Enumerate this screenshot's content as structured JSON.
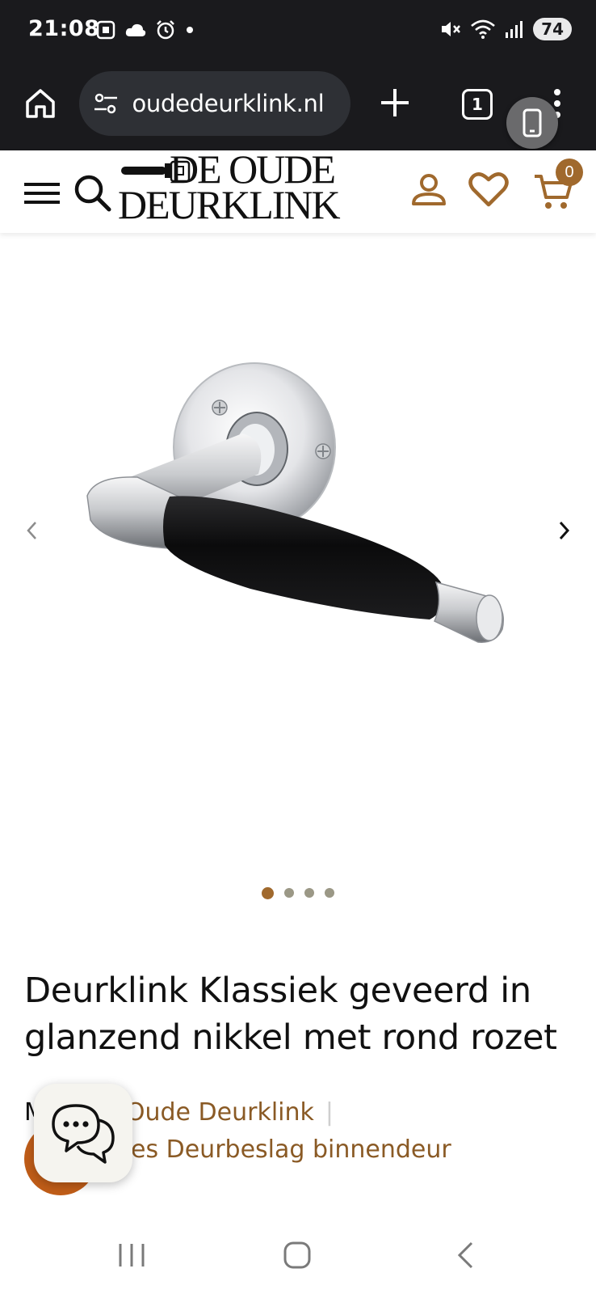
{
  "status_bar": {
    "time": "21:08",
    "left_icons": [
      "screenshot-icon",
      "cloud-icon",
      "alarm-icon",
      "dot-icon"
    ],
    "right_icons": [
      "mute-icon",
      "wifi-icon",
      "signal-icon"
    ],
    "battery": "74"
  },
  "browser": {
    "url": "deoudedeurklink.nl",
    "url_visible": " oudedeurklink.nl",
    "tab_count": "1"
  },
  "site_header": {
    "logo_line1": "DE OUDE",
    "logo_line2": "DEURKLINK",
    "cart_count": "0",
    "accent_color": "#a0692d"
  },
  "gallery": {
    "image_alt": "Deurklink Klassiek geveerd in glanzend nikkel met rond rozet",
    "slide_count": 4,
    "active_slide": 1
  },
  "product": {
    "title": "Deurklink Klassiek geveerd in glanzend nikkel met rond rozet",
    "meta_prefix": "M",
    "brand": "Oude Deurklink",
    "separator": "|",
    "category_prefix": "",
    "category": "es Deurbeslag binnendeur"
  },
  "chat": {
    "icon": "chat-bubbles-icon"
  },
  "nav_bar": {
    "icons": [
      "recents-icon",
      "home-icon",
      "back-icon"
    ]
  }
}
